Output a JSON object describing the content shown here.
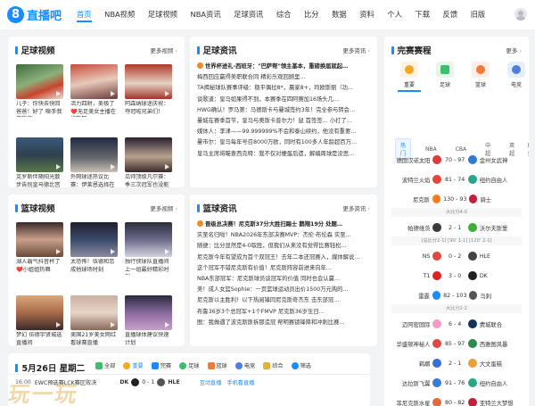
{
  "header": {
    "logo_mark": "8",
    "logo_text": "直播吧",
    "nav": [
      "首页",
      "NBA视频",
      "足球视频",
      "NBA资讯",
      "足球资讯",
      "综合",
      "比分",
      "数据",
      "资料",
      "个人",
      "下载",
      "反馈",
      "旧版"
    ]
  },
  "football_video": {
    "title": "足球视频",
    "more": "更多视频",
    "items": [
      {
        "caption": "儿子：你快去快回爸爸！好了 嗅手我能抱你…"
      },
      {
        "caption": "活力四射，美极了❤️无足美女主播在线热舞"
      },
      {
        "caption": "阿森纳球迷庆祝：夺冠啦兄弟们！"
      },
      {
        "caption": "克罗斯伴随阳光散步告别皇马德比宫殿"
      },
      {
        "caption": "外网球迷热议比赛：伊莱恩选择在替补席…"
      },
      {
        "caption": "瓜帅顶级凡尔赛：季三次冠军也没能让我…"
      },
      {
        "caption": "范戴克独自走在安菲尔德球场上"
      },
      {
        "caption": "梦幻般的队伍穿越球场"
      }
    ]
  },
  "football_news": {
    "title": "足球资讯",
    "more": "更多资讯",
    "items": [
      "世界杯进礼-西班牙：\"巴萨帮\"领主基本，重磅换届就起…",
      "梅西回应赢得美职联合同 精彩乐观回顾里…",
      "TA揭秘球队赛事评级：稳平偶拉8*，晨家8+，玛欧斯丽（功…",
      "谈歌道：皇马如果得不到，本赛季在四阿赛加16场头几…",
      "HWG确认！罗马第：马德斯卡与曼城签约3年！完全参与转会…",
      "曼城在赛季首节，皇马与奥斯卡普尔力！鼠 首签签… 小打了…",
      "媒体人：李津——99.999999%不会和泰山续约，他没有重要…",
      "曼市尔：皇马每年号召8000万欧，同时有100多人年龄超百万…",
      "皇马主席将瞄查西克特：我不仅对梗蛋后遗，解编周球是没思…"
    ]
  },
  "basketball_video": {
    "title": "篮球视频",
    "more": "更多视频",
    "items": [
      {
        "caption": "湖人霸气抖音杯了❤️小姐姐热舞"
      },
      {
        "caption": "太恐怖！伍德和恋成他球场时刻"
      },
      {
        "caption": "独行侠球队直播间上一组最好精彩时刻"
      },
      {
        "caption": "梦幻 伍德宇贤城选直播间"
      },
      {
        "caption": "美国21岁美女网红看球赛直播"
      },
      {
        "caption": "直播球体建议快速计划"
      },
      {
        "caption": "伍德宇贤城选直播间比赛"
      },
      {
        "caption": "达拉斯小牛篮球现场"
      }
    ]
  },
  "basketball_news": {
    "title": "篮球资讯",
    "more": "更多资讯",
    "items": [
      "晋级总决赛！尼克斯37分大胜扫踢士 鹅翔19分 处题…",
      "实至名归啦！NBA2026年东部决赛MVP：杰伦·布伦森 实至…",
      "随便：比分显然是4-0取胜，但我们从来没有觉得比赛轻松…",
      "尼克斯今年有望成为首个双冠王！去年二本还冠赛入，媒体解说…",
      "这个冠军不错尼克斯有价值！尼克斯阵容前进来向年…",
      "NBA东部冠军：尼克斯球员谈冠军的价值 同时也会认赢…",
      "美！成人女篮Sophie：一页篮球运动员出价1500万元购的…",
      "尼克斯以主胜利！以下热阅锋同尼克斯奇杰东 击东部冠…",
      "布鲁36岁3个总冠军+1个FMVP 尼克斯36岁生日…",
      "图：我做遇了波克斯斯拆那造冠 帮明赛锁锋降和冲刺比赛…"
    ]
  },
  "matches": {
    "title": "完赛赛程",
    "more": "更多",
    "categories": [
      {
        "label": "重要",
        "color": "#f5a623"
      },
      {
        "label": "足球",
        "color": "#3cbf6b"
      },
      {
        "label": "篮球",
        "color": "#f27a38"
      },
      {
        "label": "电竞",
        "color": "#4d7fe3"
      }
    ],
    "subtabs": [
      "热门",
      "NBA",
      "CBA",
      "中超",
      "英超"
    ],
    "subtabs_more": "更多",
    "rows": [
      {
        "home": "德国汉诺太阳",
        "score": "70 - 97",
        "away": "金州女武神",
        "hc": "#e23a3a",
        "ac": "#2d7bd6"
      },
      {
        "home": "波特兰火焰",
        "score": "81 - 74",
        "away": "纽约自由人",
        "hc": "#e0463a",
        "ac": "#2aa58a"
      },
      {
        "home": "尼克斯",
        "score": "130 - 93",
        "away": "骑士",
        "hc": "#ff7b1c",
        "ac": "#c21f3a",
        "sub": "大比分4-0"
      },
      {
        "home": "帕德维茨",
        "score": "2 - 1",
        "away": "沃尔夫斯堡",
        "hc": "#3a3a3a",
        "ac": "#3ab03a",
        "sub": "[总比分2-1] [90' 1-1] [120' 2-1]"
      },
      {
        "home": "NS",
        "score": "0 - 2",
        "away": "HLE",
        "hc": "#e04848",
        "ac": "#444444"
      },
      {
        "home": "T1",
        "score": "3 - 0",
        "away": "DK",
        "hc": "#dd2222",
        "ac": "#222222"
      },
      {
        "home": "雷霆",
        "score": "82 - 103",
        "away": "马刺",
        "hc": "#1a8cff",
        "ac": "#555555",
        "sub": "大比分2-2"
      },
      {
        "home": "迈阿密国际",
        "score": "6 - 4",
        "away": "费城联合",
        "hc": "#f39ac5",
        "ac": "#15325a"
      },
      {
        "home": "华盛顿神秘人",
        "score": "85 - 97",
        "away": "西雅图风暴",
        "hc": "#e04848",
        "ac": "#2a8a4a"
      },
      {
        "home": "鹈鹕",
        "score": "2 - 1",
        "away": "大文蛋糕",
        "hc": "#3a6fd8",
        "ac": "#e8a13a"
      },
      {
        "home": "达拉斯飞翼",
        "score": "91 - 76",
        "away": "纽约自由人",
        "hc": "#3a7bd8",
        "ac": "#2aa58a"
      },
      {
        "home": "菲尼克斯水星",
        "score": "80 - 82",
        "away": "亚特兰大梦想",
        "hc": "#e3683a",
        "ac": "#c21f3a"
      }
    ]
  },
  "bottom": {
    "date": "5月26日 星期二",
    "tabs": [
      {
        "label": "全部",
        "color": "#3cbf6b"
      },
      {
        "label": "重要",
        "color": "#f5a623"
      },
      {
        "label": "完赛",
        "color": "#1a8cff"
      },
      {
        "label": "足球",
        "color": "#3cbf6b"
      },
      {
        "label": "篮球",
        "color": "#f27a38"
      },
      {
        "label": "电竞",
        "color": "#4d7fe3"
      },
      {
        "label": "综合",
        "color": "#e3b23a"
      },
      {
        "label": "筛选",
        "color": "#1a8cff"
      }
    ],
    "match": {
      "time": "16:00",
      "league": "EWC预选赛LCK赛区败决",
      "home": "DK",
      "score": "0 - 1",
      "away": "HLE",
      "link1": "互动直播",
      "link2": "手机看直播"
    }
  },
  "watermark": "玩一玩",
  "colors": {
    "accent": "#1a8cff",
    "bg": "#f2f3f5"
  }
}
